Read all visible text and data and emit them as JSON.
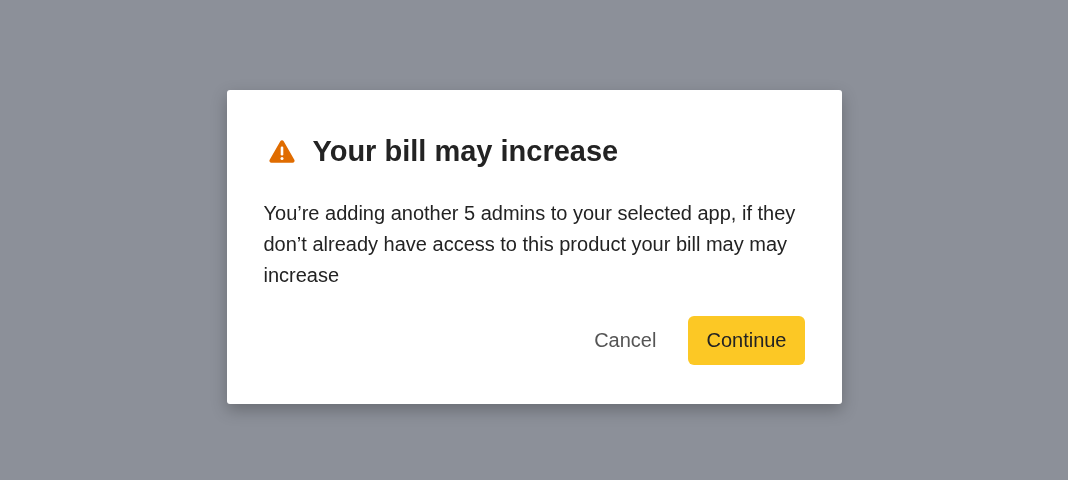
{
  "dialog": {
    "title": "Your bill may increase",
    "message": "You’re adding another 5 admins to your selected app, if they don’t already have access to this product your bill may may increase",
    "buttons": [
      {
        "label": "Cancel",
        "kind": "secondary"
      },
      {
        "label": "Continue",
        "kind": "primary"
      }
    ]
  }
}
